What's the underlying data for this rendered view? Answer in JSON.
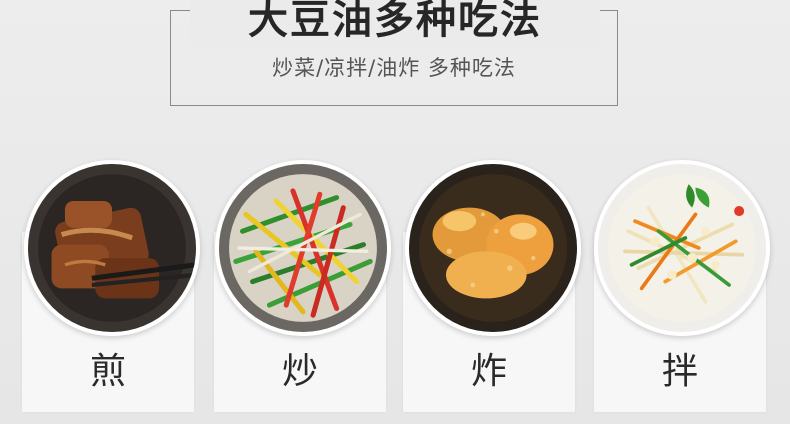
{
  "header": {
    "title": "大豆油多种吃法",
    "subtitle": "炒菜/凉拌/油炸 多种吃法"
  },
  "methods": [
    {
      "label": "煎",
      "image": "fried-pork-image"
    },
    {
      "label": "炒",
      "image": "stir-fried-peppers-image"
    },
    {
      "label": "炸",
      "image": "deep-fried-chicken-image"
    },
    {
      "label": "拌",
      "image": "cold-mushroom-salad-image"
    }
  ]
}
